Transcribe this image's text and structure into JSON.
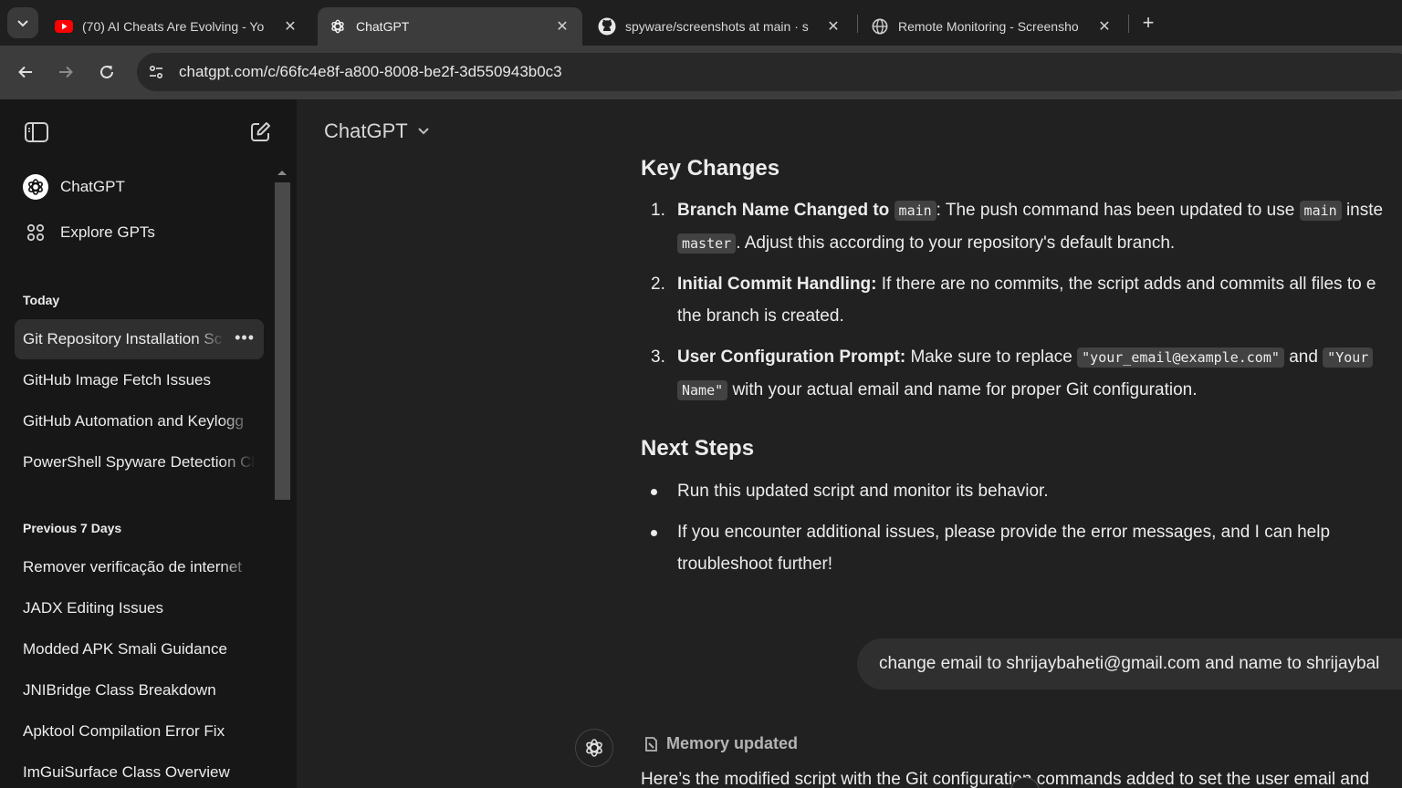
{
  "browser": {
    "tabs": [
      {
        "title": "(70) AI Cheats Are Evolving - Yo",
        "icon": "youtube-icon",
        "active": false
      },
      {
        "title": "ChatGPT",
        "icon": "chatgpt-icon",
        "active": true
      },
      {
        "title": "spyware/screenshots at main · s",
        "icon": "github-icon",
        "active": false
      },
      {
        "title": "Remote Monitoring - Screensho",
        "icon": "globe-icon",
        "active": false
      }
    ],
    "close_glyph": "✕",
    "new_tab_glyph": "+",
    "url": "chatgpt.com/c/66fc4e8f-a800-8008-be2f-3d550943b0c3"
  },
  "sidebar": {
    "top_items": [
      {
        "label": "ChatGPT",
        "icon": "chatgpt-icon"
      },
      {
        "label": "Explore GPTs",
        "icon": "grid-icon"
      }
    ],
    "sections": [
      {
        "heading": "Today",
        "items": [
          {
            "label": "Git Repository Installation Sc",
            "active": true
          },
          {
            "label": "GitHub Image Fetch Issues",
            "active": false
          },
          {
            "label": "GitHub Automation and Keylogg",
            "active": false
          },
          {
            "label": "PowerShell Spyware Detection Cl",
            "active": false
          }
        ]
      },
      {
        "heading": "Previous 7 Days",
        "items": [
          {
            "label": "Remover verificação de internet",
            "active": false
          },
          {
            "label": "JADX Editing Issues",
            "active": false
          },
          {
            "label": "Modded APK Smali Guidance",
            "active": false
          },
          {
            "label": "JNIBridge Class Breakdown",
            "active": false
          },
          {
            "label": "Apktool Compilation Error Fix",
            "active": false
          },
          {
            "label": "ImGuiSurface Class Overview",
            "active": false
          }
        ]
      }
    ],
    "more_glyph": "•••"
  },
  "header": {
    "model_name": "ChatGPT"
  },
  "conversation": {
    "key_changes_heading": "Key Changes",
    "key_changes": [
      {
        "num": "1.",
        "title": "Branch Name Changed to",
        "code1": "main",
        "text1": ": The push command has been updated to use",
        "code2": "main",
        "text2": "inste",
        "code3": "master",
        "text3": ". Adjust this according to your repository's default branch."
      },
      {
        "num": "2.",
        "title": "Initial Commit Handling:",
        "text1": "If there are no commits, the script adds and commits all files to e",
        "text2": "the branch is created."
      },
      {
        "num": "3.",
        "title": "User Configuration Prompt:",
        "text1": "Make sure to replace",
        "code1": "\"your_email@example.com\"",
        "text2": "and",
        "code2": "\"Your",
        "code3": "Name\"",
        "text3": "with your actual email and name for proper Git configuration."
      }
    ],
    "next_steps_heading": "Next Steps",
    "next_steps": [
      {
        "text": "Run this updated script and monitor its behavior."
      },
      {
        "text1": "If you encounter additional issues, please provide the error messages, and I can help",
        "text2": "troubleshoot further!"
      }
    ],
    "user_message": "change email to shrijaybaheti@gmail.com and name to shrijaybal",
    "memory_label": "Memory updated",
    "assistant_partial": "Here’s the modified script with the Git configuration commands added to set the user email and"
  }
}
